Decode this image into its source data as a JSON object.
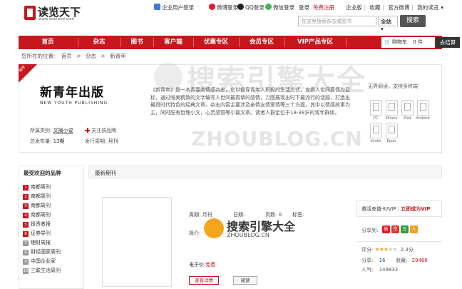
{
  "header": {
    "logo_name": "读览天下",
    "logo_domain": "www.dooland.com",
    "logins": [
      "企业用户登录",
      "微博登录",
      "QQ登录",
      "微信登录"
    ],
    "login_label": "登录",
    "register_label": "免费注册",
    "top_links": [
      "企业版",
      "收藏",
      "官方微博",
      "我的读览"
    ],
    "search_placeholder": "在这里搜索杂志或图书",
    "search_scope": "全站",
    "search_button": "搜索"
  },
  "nav": {
    "items": [
      "首页",
      "杂志",
      "图书",
      "客户端",
      "优惠专区",
      "会员专区",
      "VIP产品专区"
    ],
    "cart_label": "购物车",
    "cart_count": "0",
    "cart_unit": "件",
    "checkout_label": "去结算"
  },
  "breadcrumb": {
    "prefix": "您所在的位置:",
    "items": [
      "首页",
      "杂志",
      "新青年"
    ]
  },
  "magazine": {
    "ribbon": "推荐",
    "cover_title": "新青年出版",
    "cover_subtitle": "NEW YOUTH PUBLISHING",
    "category_label": "所属类别:",
    "category_value": "文摘小说",
    "follow_label": "关注该品牌",
    "total_label": "总发布量:",
    "total_value": "13期",
    "cycle_label": "发行周期:",
    "cycle_value": "月刊",
    "description": "《新青年》是一本青春类情感杂志，它以倡导青年人积极的生活方式，宣扬人世间真情为目标，通过唯美精致的文字编写人世间最真挚的感情，力图展现出时下最流行的话题，打造出最具时代特色的经典文章。杂志内容主要涉及亲情友情爱情等三个方面，其中以情感故事为主，同时配有哲理小文，心灵感悟等小篇文章。读者人群定位于18-38岁的青年群体。",
    "read_label": "无界阅读，支持多终端",
    "devices": [
      "PC",
      "iPhone",
      "iPad",
      "Android",
      "kindle",
      "Epub"
    ]
  },
  "sidebar": {
    "title": "最受欢迎的品牌",
    "items": [
      "南都周刊",
      "南都周刊",
      "南都周刊",
      "南都周刊",
      "投资者报",
      "证券导刊",
      "理财周报",
      "财经国家周刊",
      "中国企业家",
      "三联生活周刊"
    ]
  },
  "latest": {
    "title": "最新期刊",
    "period_label": "周期:",
    "period_value": "月刊",
    "date_label": "日期:",
    "date_value": "",
    "pages_label": "页数:",
    "pages_value": "0",
    "tags_label": "标签:",
    "intro_label": "简介:",
    "price_label": "电子价:",
    "price_value": "免费",
    "detail_button": "查看详情",
    "read_button": "阅读"
  },
  "side_panel": {
    "vip_text": "邀活充值卡/VIP",
    "vip_link": "立即成为VIP",
    "share_label": "分享到:",
    "rating_label": "评分:",
    "rating_stars": 3,
    "rating_value": "2.3分",
    "share_count_label": "分享:",
    "share_count": "16",
    "favorite_label": "收藏:",
    "favorite_count": "29468",
    "views_label": "人气:",
    "views_count": "149832"
  },
  "watermark": {
    "text": "搜索引擎大全",
    "domain": "ZHOUBLOG.CN"
  }
}
